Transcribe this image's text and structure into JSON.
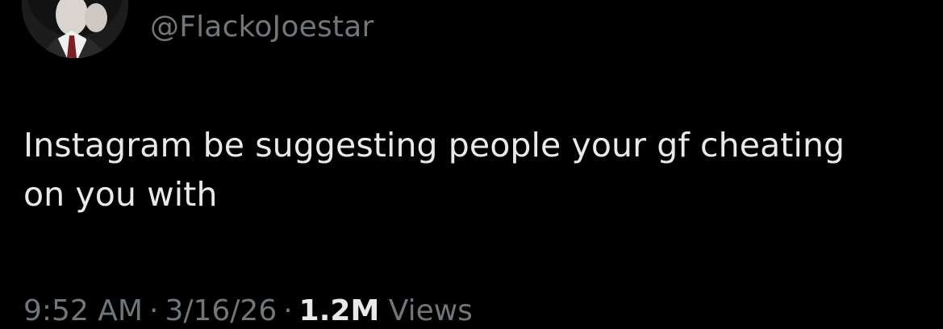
{
  "tweet": {
    "handle": "@FlackoJoestar",
    "text_lines": [
      "Instagram be suggesting people your gf cheating",
      "on you with"
    ],
    "time": "9:52 AM",
    "separator": "·",
    "date": "3/16/26",
    "views_count": "1.2M",
    "views_label": "Views"
  },
  "avatar": {
    "icon": "avatar-photo"
  },
  "colors": {
    "background": "#000000",
    "primary_text": "#e7e9ea",
    "secondary_text": "#71767b"
  }
}
